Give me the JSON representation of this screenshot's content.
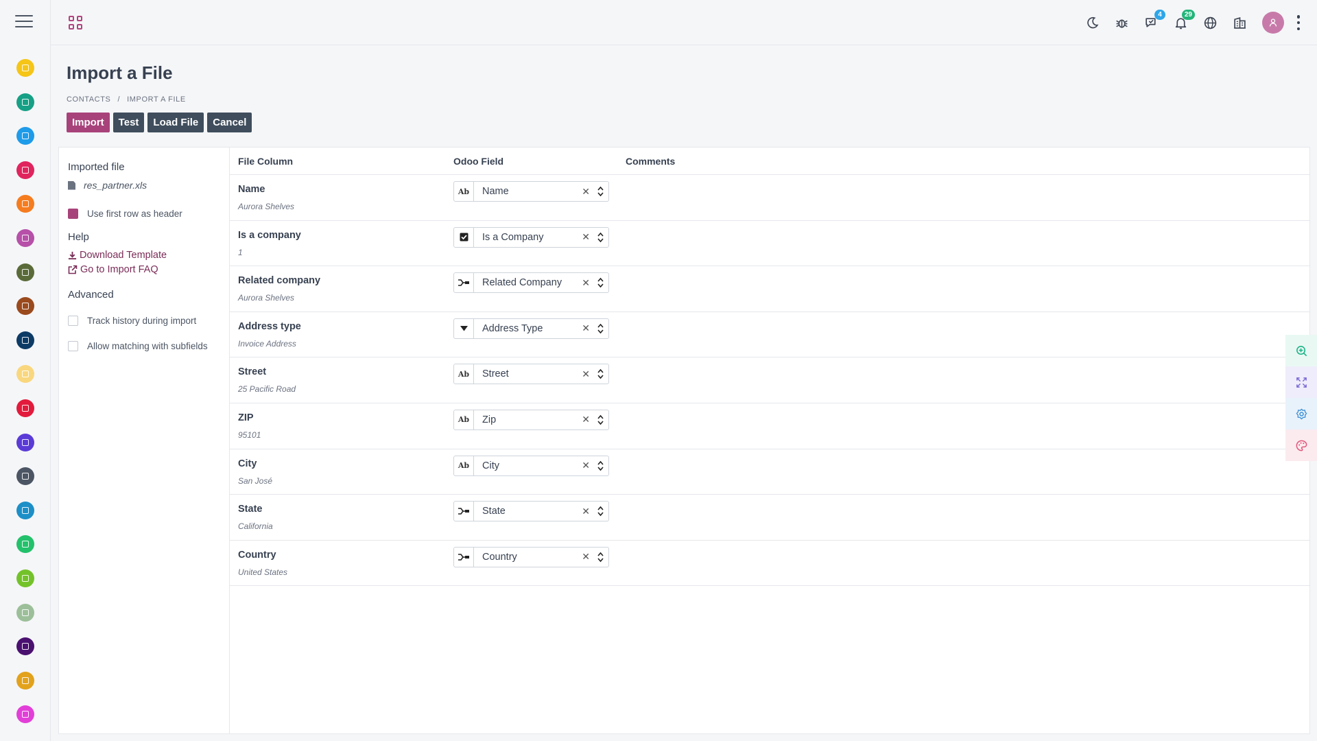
{
  "app": {
    "sidebar_apps": [
      {
        "icon": "discuss-icon",
        "color": "#f5c518"
      },
      {
        "icon": "calendar-icon",
        "color": "#16a085"
      },
      {
        "icon": "notes-icon",
        "color": "#1e9be9"
      },
      {
        "icon": "crm-icon",
        "color": "#e0245e"
      },
      {
        "icon": "sales-icon",
        "color": "#f57c1f"
      },
      {
        "icon": "invoicing-icon",
        "color": "#b650a8"
      },
      {
        "icon": "accounting-icon",
        "color": "#5a6b39"
      },
      {
        "icon": "project-icon",
        "color": "#9a4a1d"
      },
      {
        "icon": "timesheets-icon",
        "color": "#0d3b66"
      },
      {
        "icon": "website-icon",
        "color": "#f9d77e"
      },
      {
        "icon": "elearning-icon",
        "color": "#e21b3c"
      },
      {
        "icon": "events-icon",
        "color": "#5b3bd6"
      },
      {
        "icon": "inventory-icon",
        "color": "#4b5563"
      },
      {
        "icon": "manufacturing-icon",
        "color": "#1c8fc7"
      },
      {
        "icon": "employees-icon",
        "color": "#23c16b"
      },
      {
        "icon": "fleet-icon",
        "color": "#74c22a"
      },
      {
        "icon": "time-off-icon",
        "color": "#9cbf9a"
      },
      {
        "icon": "recruitment-icon",
        "color": "#4a1170"
      },
      {
        "icon": "lunch-icon",
        "color": "#e2a21c"
      },
      {
        "icon": "live-chat-icon",
        "color": "#e23fd8"
      }
    ],
    "topbar": {
      "menu_icon": "apps-grid-icon",
      "icons": [
        {
          "name": "dark-mode-icon",
          "badge": ""
        },
        {
          "name": "debug-icon",
          "badge": ""
        },
        {
          "name": "messages-icon",
          "badge": "4",
          "badge_color": "#2ea6e8"
        },
        {
          "name": "notifications-icon",
          "badge": "29",
          "badge_color": "#22b67a"
        },
        {
          "name": "language-icon",
          "badge": ""
        },
        {
          "name": "company-icon",
          "badge": ""
        }
      ]
    }
  },
  "page": {
    "title": "Import a File",
    "breadcrumb": [
      "CONTACTS",
      "IMPORT A FILE"
    ],
    "buttons": {
      "import": "Import",
      "test": "Test",
      "load_file": "Load File",
      "cancel": "Cancel"
    }
  },
  "sidebar": {
    "imported_file_title": "Imported file",
    "file_name": "res_partner.xls",
    "use_first_row": "Use first row as header",
    "use_first_row_checked": true,
    "help_title": "Help",
    "download_template": "Download Template",
    "import_faq": "Go to Import FAQ",
    "advanced_title": "Advanced",
    "track_history": "Track history during import",
    "track_history_checked": false,
    "allow_matching": "Allow matching with subfields",
    "allow_matching_checked": false
  },
  "table": {
    "headers": {
      "file_column": "File Column",
      "odoo_field": "Odoo Field",
      "comments": "Comments"
    },
    "rows": [
      {
        "column": "Name",
        "sample": "Aurora Shelves",
        "field": "Name",
        "type": "char"
      },
      {
        "column": "Is a company",
        "sample": "1",
        "field": "Is a Company",
        "type": "boolean"
      },
      {
        "column": "Related company",
        "sample": "Aurora Shelves",
        "field": "Related Company",
        "type": "relation"
      },
      {
        "column": "Address type",
        "sample": "Invoice Address",
        "field": "Address Type",
        "type": "selection"
      },
      {
        "column": "Street",
        "sample": "25 Pacific Road",
        "field": "Street",
        "type": "char"
      },
      {
        "column": "ZIP",
        "sample": "95101",
        "field": "Zip",
        "type": "char"
      },
      {
        "column": "City",
        "sample": "San José",
        "field": "City",
        "type": "char"
      },
      {
        "column": "State",
        "sample": "California",
        "field": "State",
        "type": "relation"
      },
      {
        "column": "Country",
        "sample": "United States",
        "field": "Country",
        "type": "relation"
      }
    ],
    "char_type_label": "Ab"
  },
  "floating_tools": [
    {
      "name": "zoom-in-icon",
      "bg": "#e9f8f3",
      "color": "#1fb489"
    },
    {
      "name": "fullscreen-icon",
      "bg": "#efedfb",
      "color": "#7b6bd6"
    },
    {
      "name": "settings-icon",
      "bg": "#e8f2fb",
      "color": "#3c8fd6"
    },
    {
      "name": "theme-palette-icon",
      "bg": "#fbebef",
      "color": "#e0567a"
    }
  ]
}
